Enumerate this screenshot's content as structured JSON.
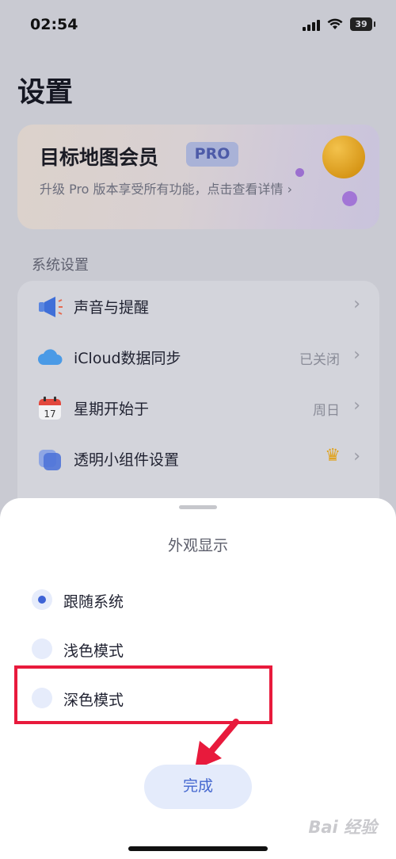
{
  "status_bar": {
    "time": "02:54",
    "battery": "39"
  },
  "page": {
    "title": "设置"
  },
  "member_card": {
    "title": "目标地图会员",
    "badge": "PRO",
    "description": "升级 Pro 版本享受所有功能，点击查看详情 ›"
  },
  "system_settings": {
    "section_label": "系统设置",
    "rows": [
      {
        "label": "声音与提醒",
        "value": "",
        "icon": "megaphone-icon"
      },
      {
        "label": "iCloud数据同步",
        "value": "已关闭",
        "icon": "cloud-icon"
      },
      {
        "label": "星期开始于",
        "value": "周日",
        "icon": "calendar-icon",
        "calendar_day": "17"
      },
      {
        "label": "透明小组件设置",
        "value": "",
        "icon": "widget-icon",
        "badge_icon": "crown-icon"
      }
    ],
    "chevron": "›"
  },
  "appearance_sheet": {
    "title": "外观显示",
    "options": [
      {
        "label": "跟随系统",
        "selected": true
      },
      {
        "label": "浅色模式",
        "selected": false
      },
      {
        "label": "深色模式",
        "selected": false
      }
    ],
    "done_label": "完成"
  },
  "watermark": "Bai 经验",
  "colors": {
    "accent": "#3e63d6",
    "highlight": "#e81a3c",
    "pro_badge": "#a9b2d7",
    "gold": "#e0a21b"
  }
}
